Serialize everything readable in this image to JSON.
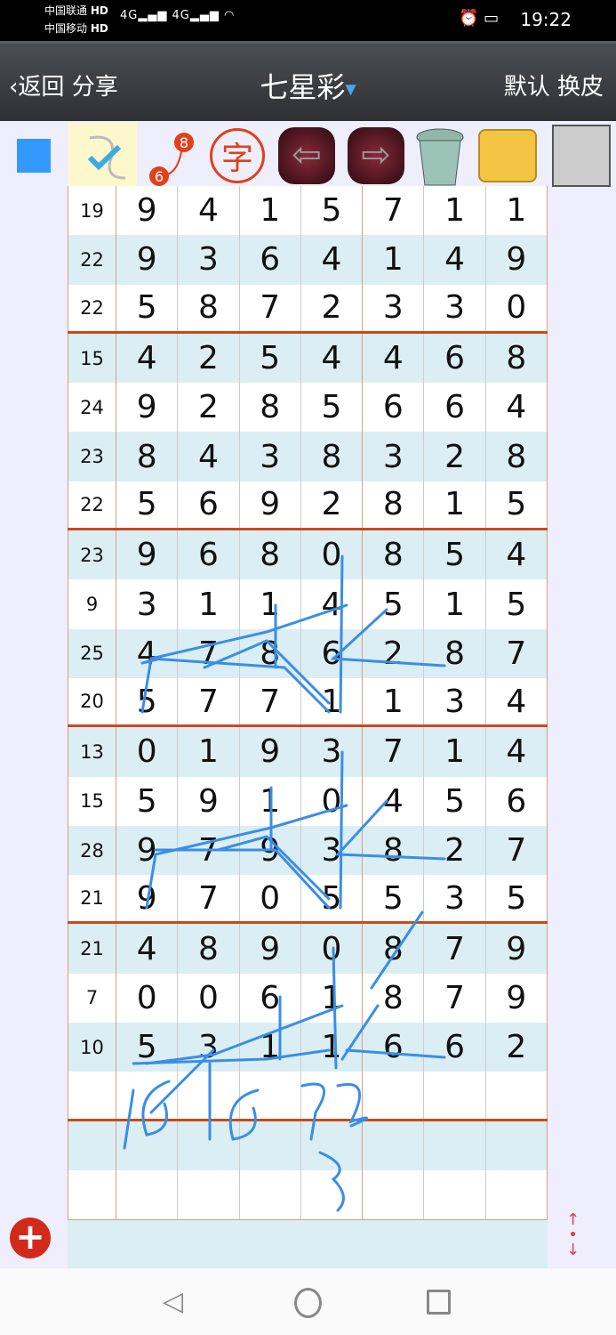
{
  "status_bar": {
    "carrier1": "中国联通",
    "carrier2": "中国移动",
    "hd": "HD",
    "network": "4G",
    "time": "19:22"
  },
  "app_bar": {
    "back_label": "返回",
    "share_label": "分享",
    "title": "七星彩",
    "default_label": "默认",
    "skin_label": "换皮"
  },
  "toolbar": {
    "icons": [
      "color-swatch-icon",
      "pen-check-icon",
      "number-link-icon",
      "text-stamp-icon",
      "undo-arrow-icon",
      "redo-arrow-icon",
      "trash-icon",
      "image-folder-icon",
      "save-floppy-icon"
    ],
    "badge_top": "8",
    "badge_bottom": "6",
    "char_label": "字",
    "swatch_color": "#3399ff"
  },
  "rows": [
    {
      "sum": "19",
      "d": [
        "9",
        "4",
        "1",
        "5",
        "7",
        "1",
        "1"
      ]
    },
    {
      "sum": "22",
      "d": [
        "9",
        "3",
        "6",
        "4",
        "1",
        "4",
        "9"
      ]
    },
    {
      "sum": "22",
      "d": [
        "5",
        "8",
        "7",
        "2",
        "3",
        "3",
        "0"
      ]
    },
    {
      "sum": "15",
      "d": [
        "4",
        "2",
        "5",
        "4",
        "4",
        "6",
        "8"
      ]
    },
    {
      "sum": "24",
      "d": [
        "9",
        "2",
        "8",
        "5",
        "6",
        "6",
        "4"
      ]
    },
    {
      "sum": "23",
      "d": [
        "8",
        "4",
        "3",
        "8",
        "3",
        "2",
        "8"
      ]
    },
    {
      "sum": "22",
      "d": [
        "5",
        "6",
        "9",
        "2",
        "8",
        "1",
        "5"
      ]
    },
    {
      "sum": "23",
      "d": [
        "9",
        "6",
        "8",
        "0",
        "8",
        "5",
        "4"
      ]
    },
    {
      "sum": "9",
      "d": [
        "3",
        "1",
        "1",
        "4",
        "5",
        "1",
        "5"
      ]
    },
    {
      "sum": "25",
      "d": [
        "4",
        "7",
        "8",
        "6",
        "2",
        "8",
        "7"
      ]
    },
    {
      "sum": "20",
      "d": [
        "5",
        "7",
        "7",
        "1",
        "1",
        "3",
        "4"
      ]
    },
    {
      "sum": "13",
      "d": [
        "0",
        "1",
        "9",
        "3",
        "7",
        "1",
        "4"
      ]
    },
    {
      "sum": "15",
      "d": [
        "5",
        "9",
        "1",
        "0",
        "4",
        "5",
        "6"
      ]
    },
    {
      "sum": "28",
      "d": [
        "9",
        "7",
        "9",
        "3",
        "8",
        "2",
        "7"
      ]
    },
    {
      "sum": "21",
      "d": [
        "9",
        "7",
        "0",
        "5",
        "5",
        "3",
        "5"
      ]
    },
    {
      "sum": "21",
      "d": [
        "4",
        "8",
        "9",
        "0",
        "8",
        "7",
        "9"
      ]
    },
    {
      "sum": "7",
      "d": [
        "0",
        "0",
        "6",
        "1",
        "8",
        "7",
        "9"
      ]
    },
    {
      "sum": "10",
      "d": [
        "5",
        "3",
        "1",
        "1",
        "6",
        "6",
        "2"
      ]
    }
  ],
  "empty_rows": 3,
  "colors": {
    "separator": "#c84a1c",
    "row_alt": "#dbeef4",
    "ink": "#3a8ee6",
    "add_button": "#d22a1a"
  }
}
